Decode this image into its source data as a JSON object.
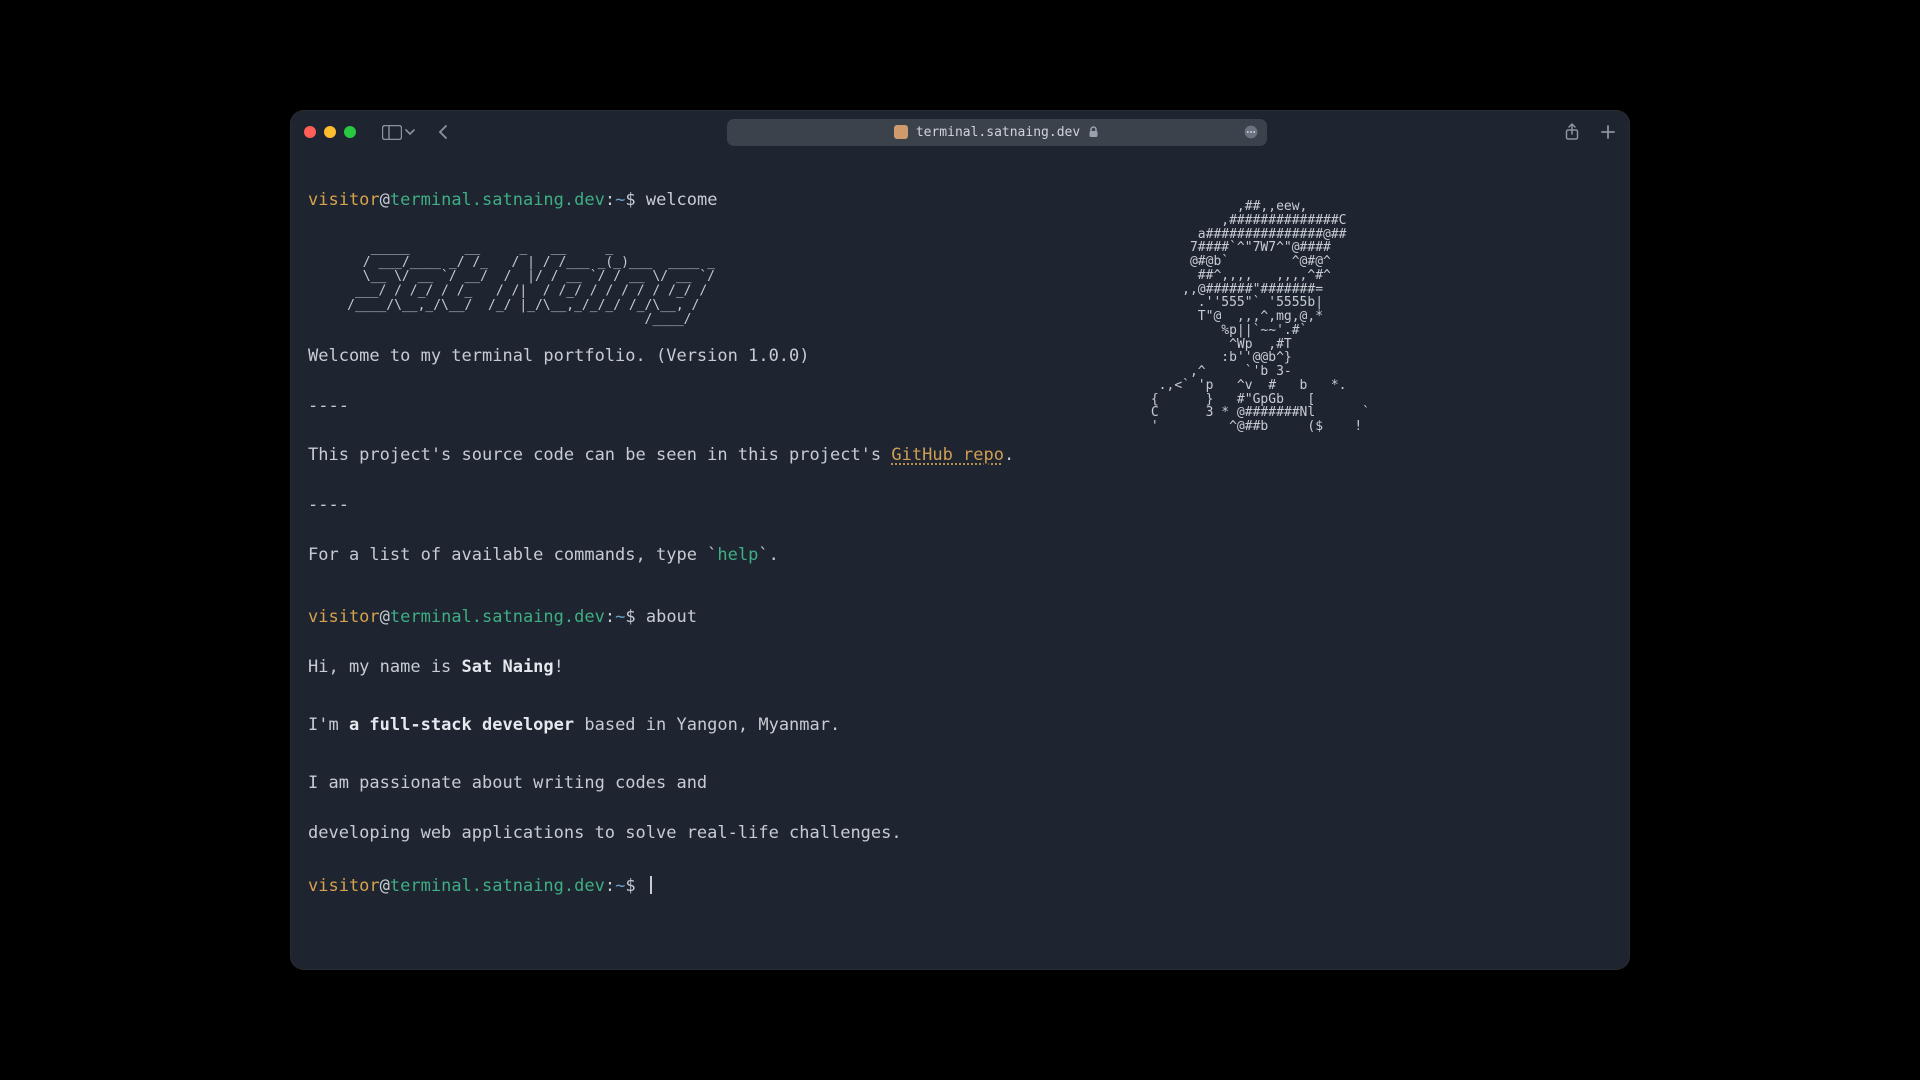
{
  "url": "terminal.satnaing.dev",
  "prompt": {
    "user": "visitor",
    "at": "@",
    "host": "terminal.satnaing.dev",
    "colon": ":",
    "path": "~",
    "dollar": "$"
  },
  "commands": {
    "welcome": "welcome",
    "about": "about"
  },
  "welcome": {
    "line1": "Welcome to my terminal portfolio. (Version 1.0.0)",
    "dash": "----",
    "source_pre": "This project's source code can be seen in this project's ",
    "source_link": "GitHub repo",
    "source_post": ".",
    "help_pre": "For a list of available commands, type `",
    "help_word": "help",
    "help_post": "`."
  },
  "about": {
    "hi_pre": "Hi, my name is ",
    "name": "Sat Naing",
    "hi_post": "!",
    "role_pre": "I'm ",
    "role_bold": "a full-stack developer",
    "role_post": " based in Yangon, Myanmar.",
    "passion1": "I am passionate about writing codes and",
    "passion2": "developing web applications to solve real-life challenges."
  },
  "ascii_name": "        _____       __     _   __     _           \n       / ___/____ _/ /_   / | / /___ _(_)___  ____ _\n       \\__ \\/ __ `/ __/  /  |/ / __ `/ / __ \\/ __ `/\n      ___/ / /_/ / /_   / /|  / /_/ / / / / / /_/ / \n     /____/\\__,_/\\__/  /_/ |_/\\__,_/_/_/ /_/\\__, /  \n                                           /____/   ",
  "ascii_face": "           ,##,,eew,\n         ,##############C\n      a###############@##\n     7####`^\"7W7^\"@####\n     @#@b`        ^@#@^\n      ##^,,,,   ,,,,^#^\n    ,,@######\"#######=\n      .''555\"` '5555b|\n      T\"@  ,,,^,mg,@,*\n         %p||`~~'.#`\n          ^Wp  ,#T\n         :b''@@b^}\n     ,^     `'b 3-\n .,<` 'p   ^v  #   b   *.\n{      }   #\"GpGb   [\nC      3 * @#######Nl      `\n'         ^@##b     ($    !"
}
